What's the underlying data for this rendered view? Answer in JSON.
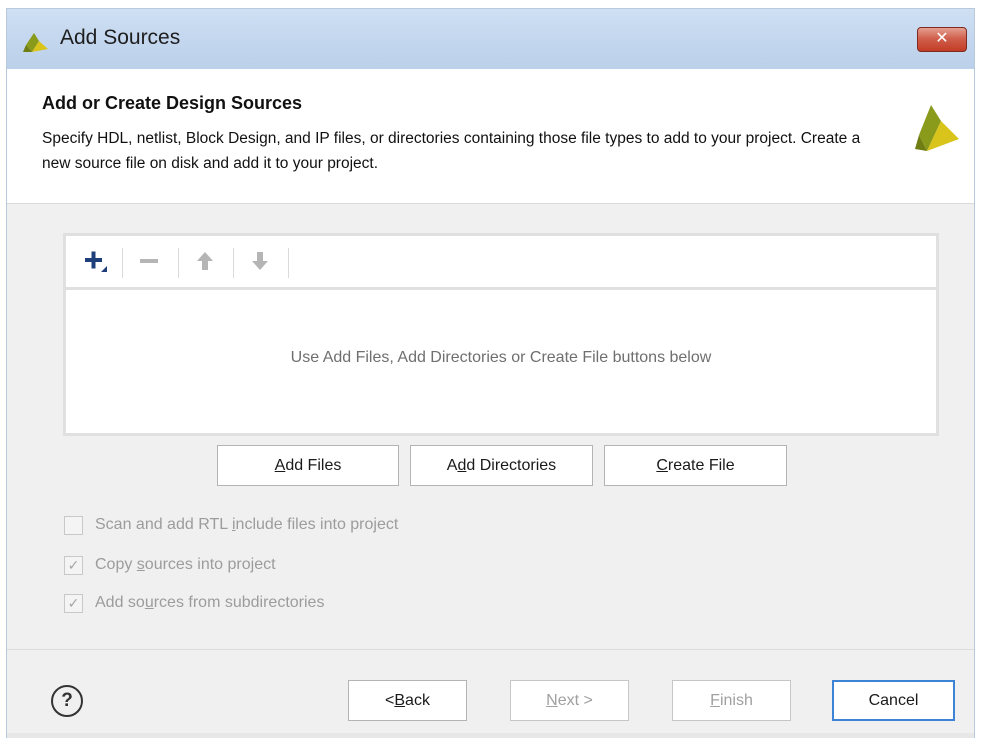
{
  "window": {
    "title": "Add Sources",
    "close_label": "✕"
  },
  "header": {
    "title": "Add or Create Design Sources",
    "description": "Specify HDL, netlist, Block Design, and IP files, or directories containing those file types to add to your project. Create a new source file on disk and add it to your project."
  },
  "sources_list": {
    "toolbar": {
      "add": "+",
      "remove": "−",
      "move_up": "↑",
      "move_down": "↓"
    },
    "empty_message": "Use Add Files, Add Directories or Create File buttons below"
  },
  "actions": {
    "add_files": {
      "pre": "",
      "key": "A",
      "post": "dd Files"
    },
    "add_directories": {
      "pre": "A",
      "key": "d",
      "post": "d Directories"
    },
    "create_file": {
      "pre": "",
      "key": "C",
      "post": "reate File"
    }
  },
  "options": [
    {
      "pre": "Scan and add RTL ",
      "key": "i",
      "post": "nclude files into project",
      "checked": false
    },
    {
      "pre": "Copy ",
      "key": "s",
      "post": "ources into project",
      "checked": true
    },
    {
      "pre": "Add so",
      "key": "u",
      "post": "rces from subdirectories",
      "checked": true
    }
  ],
  "footer": {
    "help": "?",
    "back": {
      "pre": "< ",
      "key": "B",
      "post": "ack"
    },
    "next": {
      "pre": "",
      "key": "N",
      "post": "ext >"
    },
    "finish": {
      "pre": "",
      "key": "F",
      "post": "inish"
    },
    "cancel": "Cancel"
  },
  "colors": {
    "titlebar": "#c3d6ee",
    "logo_green": "#8a9a1b",
    "logo_yellow": "#d8c41a",
    "primary_border": "#3d84d6",
    "close_red": "#c23c25"
  }
}
